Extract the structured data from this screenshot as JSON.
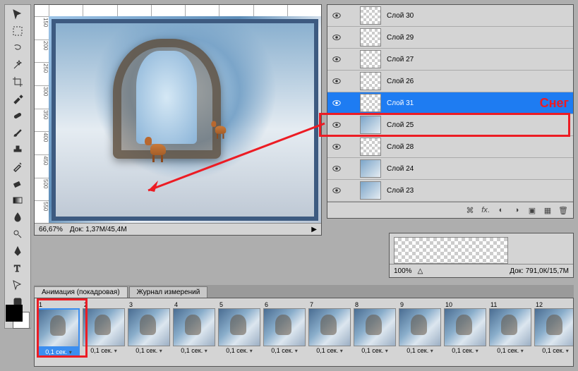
{
  "doc": {
    "zoom": "66,67%",
    "info": "Док: 1,37M/45,4M",
    "rulers_h": [
      "",
      "",
      "",
      "",
      "",
      "",
      "",
      "",
      ""
    ],
    "rulers_v": [
      "150",
      "200",
      "250",
      "300",
      "350",
      "400",
      "450",
      "500",
      "550"
    ]
  },
  "layers": {
    "items": [
      {
        "name": "Слой 30",
        "kind": "trans"
      },
      {
        "name": "Слой 29",
        "kind": "trans"
      },
      {
        "name": "Слой 27",
        "kind": "trans"
      },
      {
        "name": "Слой 26",
        "kind": "trans"
      },
      {
        "name": "Слой 31",
        "kind": "trans",
        "selected": true,
        "annot": "Снег"
      },
      {
        "name": "Слой 25",
        "kind": "img"
      },
      {
        "name": "Слой 28",
        "kind": "trans"
      },
      {
        "name": "Слой 24",
        "kind": "img"
      },
      {
        "name": "Слой 23",
        "kind": "img"
      }
    ],
    "footer_icons": [
      "link-icon",
      "fx-icon",
      "mask-icon",
      "adjust-icon",
      "group-icon",
      "new-icon",
      "trash-icon"
    ]
  },
  "nav": {
    "zoom": "100%",
    "info": "Док: 791,0К/15,7M"
  },
  "tabs": {
    "anim": "Анимация (покадровая)",
    "log": "Журнал измерений"
  },
  "anim": {
    "frame_delay": "0,1 сек.",
    "count": 12
  },
  "tools": [
    "move",
    "marquee",
    "lasso",
    "wand",
    "crop",
    "eyedrop",
    "heal",
    "brush",
    "stamp",
    "history",
    "eraser",
    "gradient",
    "blur",
    "dodge",
    "pen",
    "type",
    "path",
    "shape",
    "hand",
    "zoom"
  ]
}
